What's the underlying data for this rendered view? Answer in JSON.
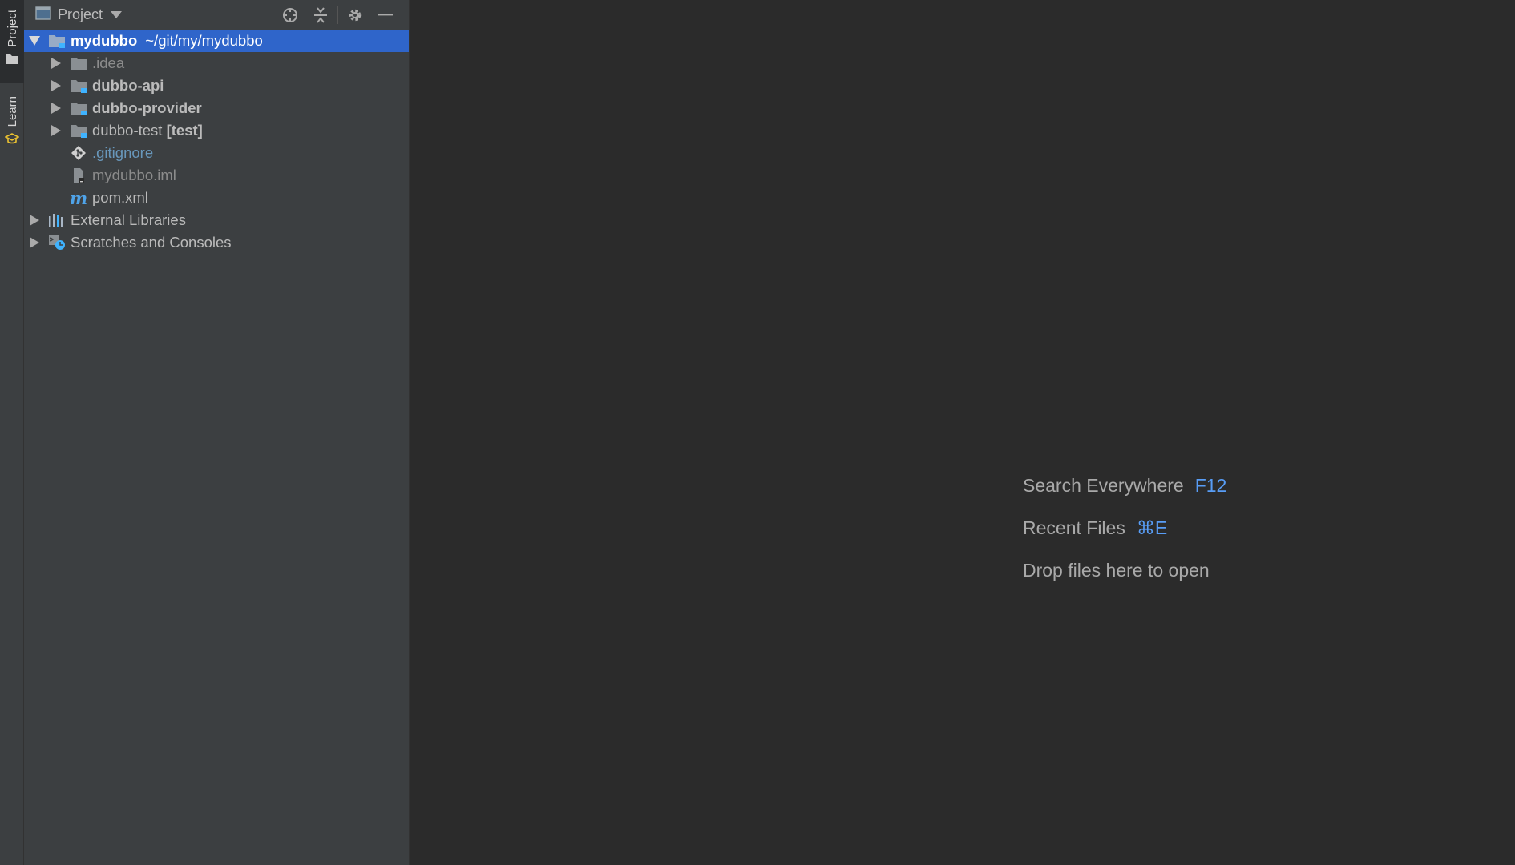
{
  "stripe": {
    "project_label": "Project",
    "learn_label": "Learn"
  },
  "panel": {
    "title": "Project",
    "tools": [
      "locate-icon",
      "collapse-all-icon",
      "gear-icon",
      "minimize-icon"
    ]
  },
  "tree": {
    "root": {
      "name": "mydubbo",
      "path": "~/git/my/mydubbo",
      "expanded": true
    },
    "items": [
      {
        "label": ".idea",
        "icon": "folder-icon"
      },
      {
        "label": "dubbo-api",
        "icon": "module-folder-icon"
      },
      {
        "label": "dubbo-provider",
        "icon": "module-folder-icon"
      },
      {
        "label": "dubbo-test",
        "suffix": "[test]",
        "icon": "module-folder-icon"
      },
      {
        "label": ".gitignore",
        "icon": "git-file-icon"
      },
      {
        "label": "mydubbo.iml",
        "icon": "iml-file-icon"
      },
      {
        "label": "pom.xml",
        "icon": "maven-icon"
      },
      {
        "label": "External Libraries",
        "icon": "libraries-icon"
      },
      {
        "label": "Scratches and Consoles",
        "icon": "scratches-icon"
      }
    ]
  },
  "editor": {
    "hints": [
      {
        "text": "Search Everywhere",
        "key": "F12"
      },
      {
        "text": "Recent Files",
        "key": "⌘E"
      },
      {
        "text": "Drop files here to open",
        "key": ""
      }
    ]
  },
  "colors": {
    "selection": "#2f65ca",
    "panel_bg": "#3c3f41",
    "editor_bg": "#2b2b2b",
    "shortcut": "#589df6",
    "git_file": "#6897bb",
    "module_marker": "#3fb3ff"
  }
}
